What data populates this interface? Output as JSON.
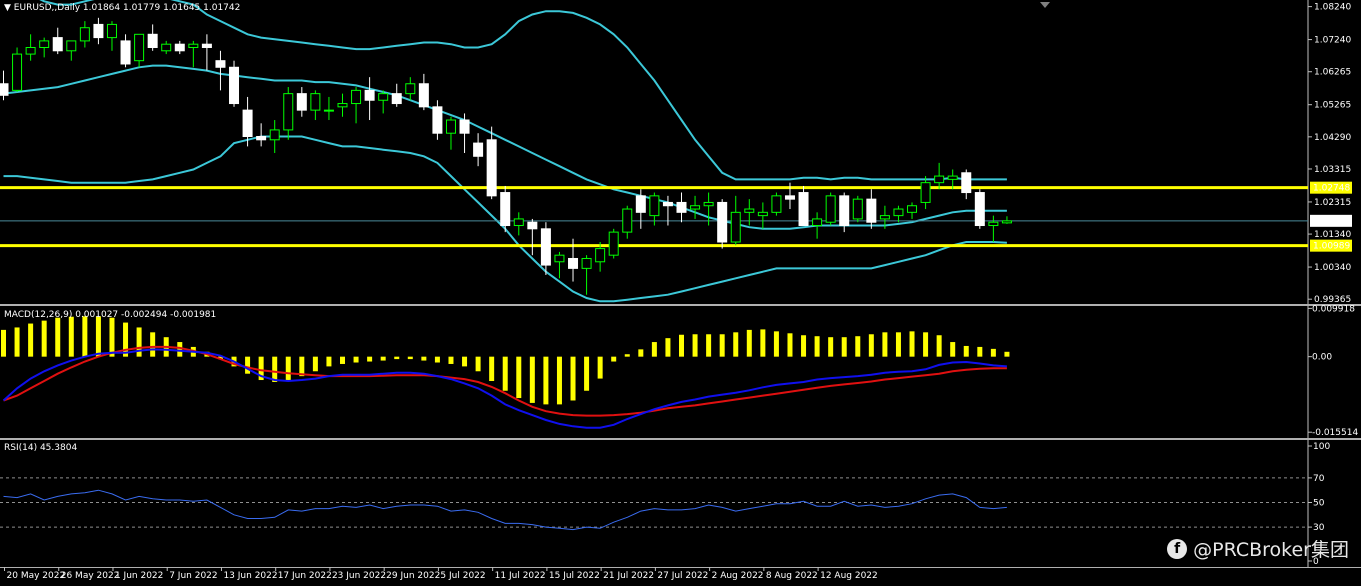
{
  "chart_data": [
    {
      "type": "candlestick",
      "symbol_info": "EURUSD,,Daily  1.01864 1.01779 1.01645 1.01742",
      "y_ticks": [
        "1.08240",
        "1.07240",
        "1.06265",
        "1.05265",
        "1.04290",
        "1.03315",
        "1.02315",
        "1.01340",
        "1.00340",
        "0.99365"
      ],
      "horizontal_lines": [
        {
          "price": 1.02748,
          "label": "1.02748",
          "color": "#ffff00"
        },
        {
          "price": 1.00989,
          "label": "1.00989",
          "color": "#ffff00"
        }
      ],
      "current_price": {
        "price": 1.01742,
        "label": "1.01742"
      },
      "ylim": [
        0.9928,
        1.0838
      ],
      "candles": [
        {
          "o": 1.059,
          "h": 1.063,
          "l": 1.054,
          "c": 1.0555
        },
        {
          "o": 1.057,
          "h": 1.07,
          "l": 1.0565,
          "c": 1.068
        },
        {
          "o": 1.068,
          "h": 1.074,
          "l": 1.066,
          "c": 1.07
        },
        {
          "o": 1.07,
          "h": 1.073,
          "l": 1.067,
          "c": 1.072
        },
        {
          "o": 1.073,
          "h": 1.076,
          "l": 1.068,
          "c": 1.069
        },
        {
          "o": 1.069,
          "h": 1.072,
          "l": 1.066,
          "c": 1.072
        },
        {
          "o": 1.072,
          "h": 1.078,
          "l": 1.07,
          "c": 1.076
        },
        {
          "o": 1.077,
          "h": 1.079,
          "l": 1.071,
          "c": 1.073
        },
        {
          "o": 1.073,
          "h": 1.078,
          "l": 1.069,
          "c": 1.077
        },
        {
          "o": 1.072,
          "h": 1.074,
          "l": 1.064,
          "c": 1.065
        },
        {
          "o": 1.066,
          "h": 1.074,
          "l": 1.064,
          "c": 1.074
        },
        {
          "o": 1.074,
          "h": 1.077,
          "l": 1.069,
          "c": 1.07
        },
        {
          "o": 1.069,
          "h": 1.072,
          "l": 1.068,
          "c": 1.071
        },
        {
          "o": 1.071,
          "h": 1.072,
          "l": 1.068,
          "c": 1.069
        },
        {
          "o": 1.07,
          "h": 1.072,
          "l": 1.064,
          "c": 1.071
        },
        {
          "o": 1.071,
          "h": 1.074,
          "l": 1.063,
          "c": 1.07
        },
        {
          "o": 1.066,
          "h": 1.069,
          "l": 1.057,
          "c": 1.064
        },
        {
          "o": 1.064,
          "h": 1.066,
          "l": 1.052,
          "c": 1.053
        },
        {
          "o": 1.051,
          "h": 1.055,
          "l": 1.04,
          "c": 1.043
        },
        {
          "o": 1.043,
          "h": 1.047,
          "l": 1.04,
          "c": 1.042
        },
        {
          "o": 1.042,
          "h": 1.048,
          "l": 1.038,
          "c": 1.045
        },
        {
          "o": 1.045,
          "h": 1.058,
          "l": 1.042,
          "c": 1.056
        },
        {
          "o": 1.056,
          "h": 1.058,
          "l": 1.049,
          "c": 1.051
        },
        {
          "o": 1.051,
          "h": 1.057,
          "l": 1.048,
          "c": 1.056
        },
        {
          "o": 1.051,
          "h": 1.055,
          "l": 1.048,
          "c": 1.051
        },
        {
          "o": 1.052,
          "h": 1.056,
          "l": 1.049,
          "c": 1.053
        },
        {
          "o": 1.053,
          "h": 1.058,
          "l": 1.047,
          "c": 1.057
        },
        {
          "o": 1.057,
          "h": 1.061,
          "l": 1.048,
          "c": 1.054
        },
        {
          "o": 1.054,
          "h": 1.057,
          "l": 1.05,
          "c": 1.056
        },
        {
          "o": 1.056,
          "h": 1.059,
          "l": 1.052,
          "c": 1.053
        },
        {
          "o": 1.056,
          "h": 1.061,
          "l": 1.054,
          "c": 1.059
        },
        {
          "o": 1.059,
          "h": 1.062,
          "l": 1.051,
          "c": 1.052
        },
        {
          "o": 1.052,
          "h": 1.054,
          "l": 1.042,
          "c": 1.044
        },
        {
          "o": 1.044,
          "h": 1.049,
          "l": 1.039,
          "c": 1.048
        },
        {
          "o": 1.048,
          "h": 1.05,
          "l": 1.038,
          "c": 1.044
        },
        {
          "o": 1.041,
          "h": 1.044,
          "l": 1.034,
          "c": 1.037
        },
        {
          "o": 1.042,
          "h": 1.046,
          "l": 1.024,
          "c": 1.025
        },
        {
          "o": 1.026,
          "h": 1.028,
          "l": 1.014,
          "c": 1.016
        },
        {
          "o": 1.016,
          "h": 1.02,
          "l": 1.013,
          "c": 1.018
        },
        {
          "o": 1.017,
          "h": 1.018,
          "l": 1.007,
          "c": 1.015
        },
        {
          "o": 1.015,
          "h": 1.017,
          "l": 1.001,
          "c": 1.004
        },
        {
          "o": 1.005,
          "h": 1.008,
          "l": 1.0,
          "c": 1.007
        },
        {
          "o": 1.006,
          "h": 1.012,
          "l": 0.999,
          "c": 1.003
        },
        {
          "o": 1.003,
          "h": 1.007,
          "l": 0.995,
          "c": 1.006
        },
        {
          "o": 1.005,
          "h": 1.011,
          "l": 1.002,
          "c": 1.009
        },
        {
          "o": 1.007,
          "h": 1.015,
          "l": 1.006,
          "c": 1.014
        },
        {
          "o": 1.014,
          "h": 1.022,
          "l": 1.012,
          "c": 1.021
        },
        {
          "o": 1.025,
          "h": 1.027,
          "l": 1.015,
          "c": 1.02
        },
        {
          "o": 1.019,
          "h": 1.026,
          "l": 1.016,
          "c": 1.025
        },
        {
          "o": 1.023,
          "h": 1.025,
          "l": 1.016,
          "c": 1.022
        },
        {
          "o": 1.023,
          "h": 1.026,
          "l": 1.017,
          "c": 1.02
        },
        {
          "o": 1.021,
          "h": 1.025,
          "l": 1.018,
          "c": 1.022
        },
        {
          "o": 1.022,
          "h": 1.026,
          "l": 1.016,
          "c": 1.023
        },
        {
          "o": 1.023,
          "h": 1.024,
          "l": 1.009,
          "c": 1.011
        },
        {
          "o": 1.011,
          "h": 1.025,
          "l": 1.01,
          "c": 1.02
        },
        {
          "o": 1.02,
          "h": 1.024,
          "l": 1.016,
          "c": 1.021
        },
        {
          "o": 1.019,
          "h": 1.023,
          "l": 1.015,
          "c": 1.02
        },
        {
          "o": 1.02,
          "h": 1.026,
          "l": 1.019,
          "c": 1.025
        },
        {
          "o": 1.025,
          "h": 1.029,
          "l": 1.021,
          "c": 1.024
        },
        {
          "o": 1.026,
          "h": 1.028,
          "l": 1.016,
          "c": 1.016
        },
        {
          "o": 1.016,
          "h": 1.02,
          "l": 1.012,
          "c": 1.018
        },
        {
          "o": 1.017,
          "h": 1.026,
          "l": 1.016,
          "c": 1.025
        },
        {
          "o": 1.025,
          "h": 1.026,
          "l": 1.014,
          "c": 1.016
        },
        {
          "o": 1.018,
          "h": 1.025,
          "l": 1.017,
          "c": 1.024
        },
        {
          "o": 1.024,
          "h": 1.027,
          "l": 1.015,
          "c": 1.017
        },
        {
          "o": 1.018,
          "h": 1.022,
          "l": 1.015,
          "c": 1.019
        },
        {
          "o": 1.019,
          "h": 1.022,
          "l": 1.017,
          "c": 1.021
        },
        {
          "o": 1.02,
          "h": 1.023,
          "l": 1.018,
          "c": 1.022
        },
        {
          "o": 1.023,
          "h": 1.031,
          "l": 1.021,
          "c": 1.029
        },
        {
          "o": 1.029,
          "h": 1.035,
          "l": 1.027,
          "c": 1.031
        },
        {
          "o": 1.03,
          "h": 1.033,
          "l": 1.027,
          "c": 1.031
        },
        {
          "o": 1.032,
          "h": 1.033,
          "l": 1.024,
          "c": 1.026
        },
        {
          "o": 1.026,
          "h": 1.027,
          "l": 1.015,
          "c": 1.016
        },
        {
          "o": 1.016,
          "h": 1.019,
          "l": 1.011,
          "c": 1.017
        },
        {
          "o": 1.0168,
          "h": 1.0188,
          "l": 1.0165,
          "c": 1.0174
        }
      ],
      "bollinger": {
        "upper": [
          1.091,
          1.089,
          1.086,
          1.084,
          1.083,
          1.083,
          1.084,
          1.085,
          1.086,
          1.087,
          1.087,
          1.086,
          1.085,
          1.084,
          1.083,
          1.08,
          1.078,
          1.076,
          1.074,
          1.073,
          1.0725,
          1.072,
          1.0715,
          1.071,
          1.0705,
          1.07,
          1.0695,
          1.0695,
          1.07,
          1.0705,
          1.071,
          1.0715,
          1.0715,
          1.071,
          1.07,
          1.07,
          1.071,
          1.074,
          1.078,
          1.08,
          1.081,
          1.081,
          1.0805,
          1.079,
          1.077,
          1.074,
          1.07,
          1.065,
          1.06,
          1.054,
          1.048,
          1.042,
          1.037,
          1.032,
          1.03,
          1.03,
          1.03,
          1.03,
          1.03,
          1.0305,
          1.0305,
          1.03,
          1.0305,
          1.0305,
          1.03,
          1.03,
          1.03,
          1.03,
          1.03,
          1.03,
          1.0305,
          1.03,
          1.03,
          1.03,
          1.03
        ],
        "middle": [
          1.056,
          1.0565,
          1.057,
          1.0575,
          1.058,
          1.059,
          1.06,
          1.061,
          1.062,
          1.063,
          1.064,
          1.0645,
          1.0645,
          1.064,
          1.0635,
          1.063,
          1.062,
          1.0615,
          1.061,
          1.0605,
          1.06,
          1.06,
          1.06,
          1.0595,
          1.0595,
          1.059,
          1.0585,
          1.0575,
          1.0565,
          1.0555,
          1.054,
          1.0525,
          1.051,
          1.0495,
          1.048,
          1.046,
          1.044,
          1.042,
          1.04,
          1.038,
          1.036,
          1.034,
          1.032,
          1.03,
          1.0285,
          1.027,
          1.026,
          1.025,
          1.024,
          1.023,
          1.0215,
          1.02,
          1.0185,
          1.0175,
          1.0165,
          1.0155,
          1.015,
          1.015,
          1.015,
          1.0155,
          1.016,
          1.016,
          1.016,
          1.016,
          1.016,
          1.016,
          1.0165,
          1.017,
          1.018,
          1.019,
          1.02,
          1.0205,
          1.0205,
          1.0205,
          1.0205
        ],
        "lower": [
          1.031,
          1.031,
          1.0305,
          1.03,
          1.0295,
          1.029,
          1.029,
          1.029,
          1.029,
          1.029,
          1.0295,
          1.03,
          1.031,
          1.032,
          1.033,
          1.035,
          1.037,
          1.041,
          1.042,
          1.043,
          1.043,
          1.043,
          1.043,
          1.042,
          1.041,
          1.04,
          1.04,
          1.0395,
          1.039,
          1.0385,
          1.038,
          1.037,
          1.035,
          1.031,
          1.027,
          1.023,
          1.019,
          1.015,
          1.01,
          1.006,
          1.002,
          0.999,
          0.996,
          0.994,
          0.993,
          0.993,
          0.9935,
          0.994,
          0.9945,
          0.995,
          0.996,
          0.997,
          0.998,
          0.999,
          1.0,
          1.001,
          1.002,
          1.003,
          1.003,
          1.003,
          1.003,
          1.003,
          1.003,
          1.003,
          1.003,
          1.004,
          1.005,
          1.006,
          1.007,
          1.0085,
          1.01,
          1.011,
          1.011,
          1.011,
          1.0108
        ]
      }
    },
    {
      "type": "macd",
      "label": "MACD(12,26,9) 0.001027 -0.002494 -0.001981",
      "y_ticks": [
        "0.009918",
        "0.00",
        "-0.015514"
      ],
      "ylim": [
        -0.0165,
        0.0102
      ],
      "histogram": [
        0.0055,
        0.006,
        0.0068,
        0.0074,
        0.008,
        0.0082,
        0.0083,
        0.0083,
        0.008,
        0.007,
        0.006,
        0.005,
        0.004,
        0.003,
        0.002,
        0.001,
        -0.0005,
        -0.002,
        -0.0035,
        -0.0048,
        -0.0052,
        -0.005,
        -0.004,
        -0.003,
        -0.002,
        -0.0015,
        -0.0012,
        -0.001,
        -0.0008,
        -0.0005,
        -0.0005,
        -0.0008,
        -0.0012,
        -0.0015,
        -0.002,
        -0.003,
        -0.005,
        -0.007,
        -0.0085,
        -0.0095,
        -0.0098,
        -0.0098,
        -0.009,
        -0.007,
        -0.0045,
        -0.001,
        0.0005,
        0.0015,
        0.003,
        0.0038,
        0.0045,
        0.0046,
        0.0046,
        0.0046,
        0.005,
        0.0055,
        0.0056,
        0.0052,
        0.0048,
        0.0044,
        0.0042,
        0.004,
        0.004,
        0.0042,
        0.0046,
        0.005,
        0.005,
        0.0052,
        0.005,
        0.0044,
        0.003,
        0.0022,
        0.002,
        0.0016,
        0.001
      ],
      "signal_line": [
        -0.009,
        -0.008,
        -0.0065,
        -0.005,
        -0.0035,
        -0.0022,
        -0.001,
        0.0,
        0.0008,
        0.0014,
        0.0018,
        0.002,
        0.002,
        0.0018,
        0.0012,
        0.0005,
        -0.0005,
        -0.0015,
        -0.0022,
        -0.0028,
        -0.0031,
        -0.0034,
        -0.0036,
        -0.0038,
        -0.004,
        -0.004,
        -0.004,
        -0.004,
        -0.0039,
        -0.0038,
        -0.0038,
        -0.0038,
        -0.004,
        -0.0043,
        -0.0046,
        -0.0052,
        -0.0062,
        -0.0075,
        -0.009,
        -0.0103,
        -0.0112,
        -0.0117,
        -0.012,
        -0.0121,
        -0.0121,
        -0.012,
        -0.0118,
        -0.0115,
        -0.0111,
        -0.0106,
        -0.0103,
        -0.01,
        -0.0096,
        -0.0092,
        -0.0088,
        -0.0084,
        -0.008,
        -0.0076,
        -0.0072,
        -0.0068,
        -0.0064,
        -0.006,
        -0.0057,
        -0.0054,
        -0.0051,
        -0.0047,
        -0.0044,
        -0.0041,
        -0.0038,
        -0.0035,
        -0.003,
        -0.0027,
        -0.0025,
        -0.0024,
        -0.0024
      ],
      "macd_line": [
        -0.009,
        -0.0065,
        -0.0045,
        -0.003,
        -0.0018,
        -0.0008,
        0.0,
        0.0006,
        0.0008,
        0.0008,
        0.0012,
        0.0015,
        0.0014,
        0.0012,
        0.001,
        0.0008,
        0.0002,
        -0.001,
        -0.0025,
        -0.004,
        -0.0048,
        -0.005,
        -0.0048,
        -0.0045,
        -0.004,
        -0.0037,
        -0.0037,
        -0.0037,
        -0.0035,
        -0.0033,
        -0.0033,
        -0.0035,
        -0.004,
        -0.0046,
        -0.0055,
        -0.0065,
        -0.008,
        -0.0098,
        -0.011,
        -0.012,
        -0.013,
        -0.0138,
        -0.0143,
        -0.0146,
        -0.0146,
        -0.014,
        -0.0128,
        -0.0118,
        -0.0108,
        -0.01,
        -0.0093,
        -0.0088,
        -0.0082,
        -0.0078,
        -0.0074,
        -0.0069,
        -0.0063,
        -0.0058,
        -0.0055,
        -0.0052,
        -0.0047,
        -0.0044,
        -0.0042,
        -0.004,
        -0.0037,
        -0.0033,
        -0.0031,
        -0.003,
        -0.0026,
        -0.0017,
        -0.0012,
        -0.0011,
        -0.0014,
        -0.0018,
        -0.002
      ]
    },
    {
      "type": "line",
      "label": "RSI(14) 45.3804",
      "y_ticks": [
        "100",
        "70",
        "50",
        "30",
        "0"
      ],
      "levels": [
        70,
        50,
        30
      ],
      "ylim": [
        0,
        100
      ],
      "values": [
        55,
        54,
        57,
        52,
        55,
        57,
        58,
        60,
        57,
        52,
        55,
        53,
        52,
        52,
        51,
        52,
        46,
        40,
        37,
        37,
        38,
        44,
        43,
        45,
        45,
        47,
        46,
        48,
        45,
        47,
        48,
        48,
        47,
        43,
        44,
        42,
        37,
        33,
        33,
        32,
        30,
        29,
        28,
        30,
        29,
        34,
        38,
        43,
        45,
        44,
        44,
        45,
        48,
        46,
        43,
        45,
        47,
        49,
        49,
        51,
        47,
        47,
        51,
        47,
        48,
        46,
        47,
        49,
        53,
        56,
        57,
        54,
        46,
        45,
        46
      ]
    }
  ],
  "x_ticks": [
    "20 May 2022",
    "26 May 2022",
    "1 Jun 2022",
    "7 Jun 2022",
    "13 Jun 2022",
    "17 Jun 2022",
    "23 Jun 2022",
    "29 Jun 2022",
    "5 Jul 2022",
    "11 Jul 2022",
    "15 Jul 2022",
    "21 Jul 2022",
    "27 Jul 2022",
    "2 Aug 2022",
    "8 Aug 2022",
    "12 Aug 2022"
  ],
  "watermark": "@PRCBroker集团",
  "colors": {
    "bg": "#000000",
    "bull": "#00ff00",
    "bear": "#ffffff",
    "bands": "#3cc8d8",
    "hline": "#ffff00",
    "hist": "#ffff00",
    "macd": "#1010ee",
    "signal": "#e01010",
    "rsi": "#3a6cf0",
    "grid": "#808080"
  }
}
